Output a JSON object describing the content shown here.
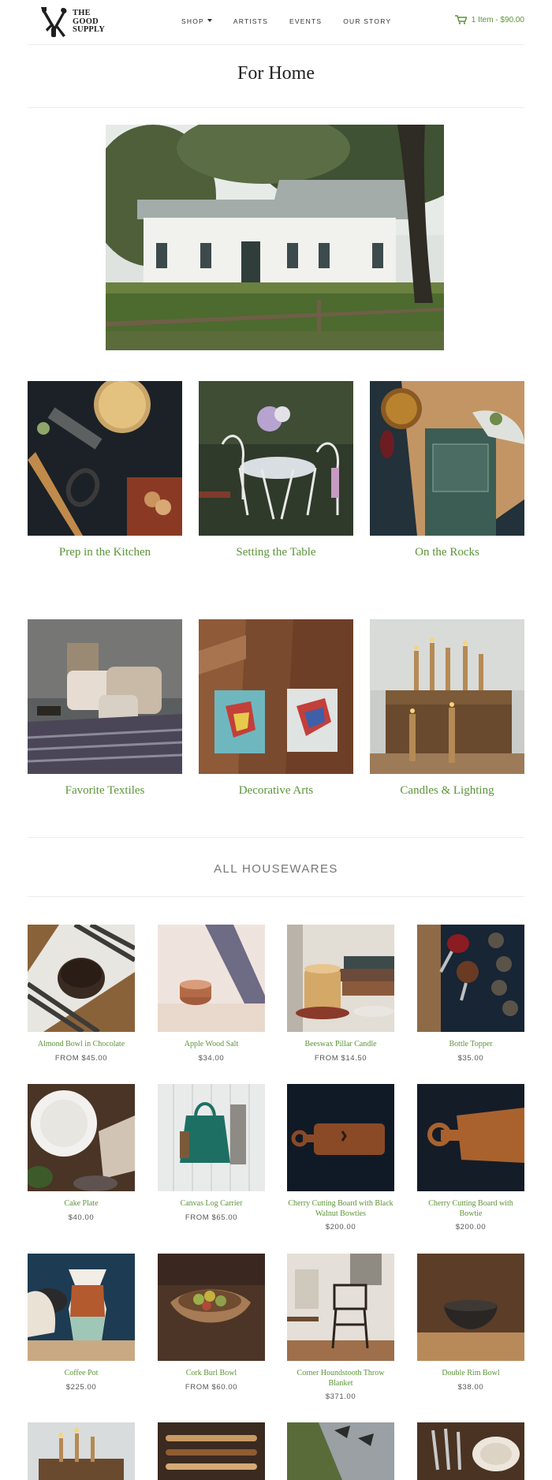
{
  "brand": {
    "line1": "THE",
    "line2": "GOOD",
    "line3": "SUPPLY"
  },
  "nav": {
    "shop": "SHOP",
    "artists": "ARTISTS",
    "events": "EVENTS",
    "our_story": "OUR STORY"
  },
  "cart": {
    "label": "1 Item - $90.00"
  },
  "page": {
    "title": "For Home"
  },
  "categories": [
    {
      "label": "Prep in the Kitchen"
    },
    {
      "label": "Setting the Table"
    },
    {
      "label": "On the Rocks"
    },
    {
      "label": "Favorite Textiles"
    },
    {
      "label": "Decorative Arts"
    },
    {
      "label": "Candles & Lighting"
    }
  ],
  "section": {
    "heading": "ALL HOUSEWARES"
  },
  "products": [
    {
      "name": "Almond Bowl in Chocolate",
      "price": "FROM $45.00"
    },
    {
      "name": "Apple Wood Salt",
      "price": "$34.00"
    },
    {
      "name": "Beeswax Pillar Candle",
      "price": "FROM $14.50"
    },
    {
      "name": "Bottle Topper",
      "price": "$35.00"
    },
    {
      "name": "Cake Plate",
      "price": "$40.00"
    },
    {
      "name": "Canvas Log Carrier",
      "price": "FROM $65.00"
    },
    {
      "name": "Cherry Cutting Board with Black Walnut Bowties",
      "price": "$200.00"
    },
    {
      "name": "Cherry Cutting Board with Bowtie",
      "price": "$200.00"
    },
    {
      "name": "Coffee Pot",
      "price": "$225.00"
    },
    {
      "name": "Cork Burl Bowl",
      "price": "FROM $60.00"
    },
    {
      "name": "Corner Houndstooth Throw Blanket",
      "price": "$371.00"
    },
    {
      "name": "Double Rim Bowl",
      "price": "$38.00"
    }
  ],
  "colors": {
    "accent": "#5c9438",
    "rule": "#ececec",
    "text": "#333333"
  },
  "icons": {
    "cart": "cart-icon",
    "logo": "tools-logo-icon",
    "caret": "chevron-down-icon"
  }
}
